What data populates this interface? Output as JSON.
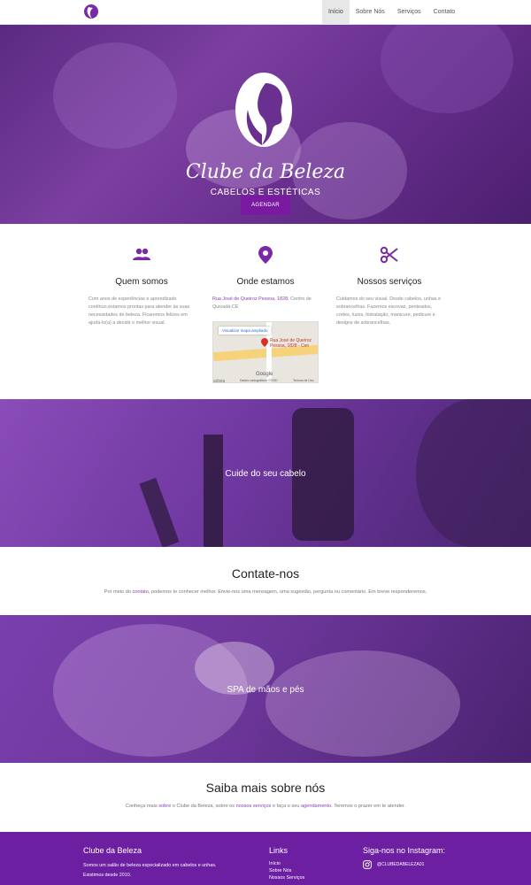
{
  "nav": {
    "items": [
      {
        "label": "Início",
        "active": true
      },
      {
        "label": "Sobre Nós",
        "active": false
      },
      {
        "label": "Serviços",
        "active": false
      },
      {
        "label": "Contato",
        "active": false
      }
    ]
  },
  "hero": {
    "title": "Clube da Beleza",
    "subtitle": "CABELOS E ESTÉTICAS",
    "cta": "AGENDAR"
  },
  "features": {
    "about": {
      "icon": "people-icon",
      "title": "Quem somos",
      "text": "Com anos de experiências e aprendizado contínuo,estamos prontas para atender às suas necessidades de beleza. Ficaremos felizes em ajudá-lo(a) a decidir o melhor visual."
    },
    "location": {
      "icon": "map-pin-icon",
      "title": "Onde estamos",
      "address_link": "Rua José de Queiroz Pessoa, 1828",
      "address_rest": ", Centro de Quixadá-CE",
      "map": {
        "button": "Visualizar mapa ampliado",
        "pin_label": "Rua José de Queiroz Pessoa, 1828 - Cen",
        "attribution": "Dados cartográficos ©2020",
        "terms": "Termos de Uso",
        "place": "adista",
        "provider": "Google"
      }
    },
    "services": {
      "icon": "scissors-icon",
      "title": "Nossos serviços",
      "text": "Cuidamos do seu visual. Desde cabelos, unhas e sobrancelhas. Fazemos escovas, penteados, cortes, luzes, hidratação, manicure, pedicure e designs de sobrancelhas."
    }
  },
  "banner1": {
    "text": "Cuide do seu cabelo"
  },
  "contact": {
    "title": "Contate-nos",
    "text_before": "Por meio do ",
    "link": "contato",
    "text_after": ", podemos te conhecer melhor. Envie-nos uma mensagem, uma sugestão, pergunta ou comentário. Em breve responderemos."
  },
  "banner2": {
    "text": "SPA de mãos e pés"
  },
  "about": {
    "title": "Saiba mais sobre nós",
    "t1": "Conheça mais ",
    "l1": "sobre",
    "t2": " o Clube da Beleza, sobre os ",
    "l2": "nossos serviços",
    "t3": " e faça o seu ",
    "l3": "agendamento",
    "t4": ". Teremos o prazer em te atender."
  },
  "footer": {
    "brand": "Clube da Beleza",
    "desc1": "Somos um salão de beleza especializado em cabelos e unhas.",
    "desc2": "Existimos desde 2010.",
    "links_title": "Links",
    "links": [
      "Início",
      "Sobre Nós",
      "Nossos Serviços"
    ],
    "social_title": "Siga-nos no Instagram:",
    "instagram": "@CLUBEDABELEZA01"
  },
  "colors": {
    "brand": "#7a1aa0",
    "accent": "#8a3fb0",
    "footer": "#6c1fa0",
    "icon": "#7a2aa6"
  }
}
